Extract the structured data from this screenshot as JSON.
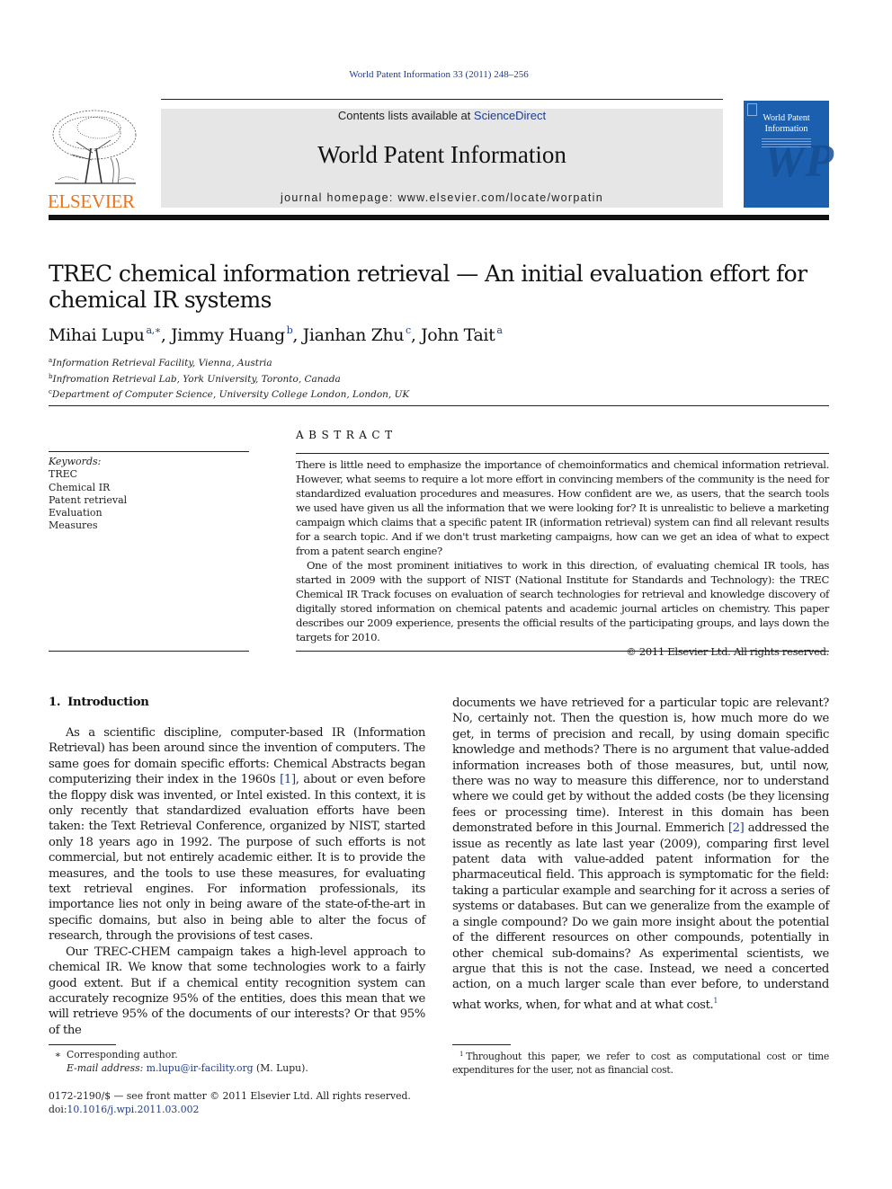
{
  "journal_ref": "World Patent Information 33 (2011) 248–256",
  "masthead": {
    "contents_prefix": "Contents lists available at ",
    "contents_link": "ScienceDirect",
    "journal_title": "World Patent Information",
    "homepage": "journal homepage: www.elsevier.com/locate/worpatin",
    "publisher": "ELSEVIER",
    "cover_title_line1": "World Patent",
    "cover_title_line2": "Information",
    "cover_monogram": "WP"
  },
  "article": {
    "title": "TREC chemical information retrieval — An initial evaluation effort for chemical IR systems",
    "authors": [
      {
        "name": "Mihai Lupu",
        "sup": "a,∗",
        "sep": ", "
      },
      {
        "name": "Jimmy Huang",
        "sup": "b",
        "sep": ", "
      },
      {
        "name": "Jianhan Zhu",
        "sup": "c",
        "sep": ", "
      },
      {
        "name": "John Tait",
        "sup": "a",
        "sep": ""
      }
    ],
    "affiliations": [
      {
        "sup": "a",
        "text": "Information Retrieval Facility, Vienna, Austria"
      },
      {
        "sup": "b",
        "text": "Infromation Retrieval Lab, York University, Toronto, Canada"
      },
      {
        "sup": "c",
        "text": "Department of Computer Science, University College London, London, UK"
      }
    ]
  },
  "keywords": {
    "label": "Keywords:",
    "items": [
      "TREC",
      "Chemical IR",
      "Patent retrieval",
      "Evaluation",
      "Measures"
    ]
  },
  "abstract": {
    "heading": "ABSTRACT",
    "paragraphs": [
      "There is little need to emphasize the importance of chemoinformatics and chemical information retrieval. However, what seems to require a lot more effort in convincing members of the community is the need for standardized evaluation procedures and measures. How confident are we, as users, that the search tools we used have given us all the information that we were looking for? It is unrealistic to believe a marketing campaign which claims that a specific patent IR (information retrieval) system can find all relevant results for a search topic. And if we don't trust marketing campaigns, how can we get an idea of what to expect from a patent search engine?",
      "One of the most prominent initiatives to work in this direction, of evaluating chemical IR tools, has started in 2009 with the support of NIST (National Institute for Standards and Technology): the TREC Chemical IR Track focuses on evaluation of search technologies for retrieval and knowledge discovery of digitally stored information on chemical patents and academic journal articles on chemistry. This paper describes our 2009 experience, presents the official results of the participating groups, and lays down the targets for 2010."
    ],
    "copyright": "© 2011 Elsevier Ltd. All rights reserved."
  },
  "introduction": {
    "number": "1.",
    "title": "Introduction",
    "p1_a": "As a scientific discipline, computer-based IR (Information Retrieval) has been around since the invention of computers. The same goes for domain specific efforts: Chemical Abstracts began computerizing their index in the 1960s ",
    "p1_ref": "[1]",
    "p1_b": ", about or even before the floppy disk was invented, or Intel existed. In this context, it is only recently that standardized evaluation efforts have been taken: the Text Retrieval Conference, organized by NIST, started only 18 years ago in 1992. The purpose of such efforts is not commercial, but not entirely academic either. It is to provide the measures, and the tools to use these measures, for evaluating text retrieval engines. For information professionals, its importance lies not only in being aware of the state-of-the-art in specific domains, but also in being able to alter the focus of research, through the provisions of test cases.",
    "p2": "Our TREC-CHEM campaign takes a high-level approach to chemical IR. We know that some technologies work to a fairly good extent. But if a chemical entity recognition system can accurately recognize 95% of the entities, does this mean that we will retrieve 95% of the documents of our interests? Or that 95% of the",
    "p3_a": "documents we have retrieved for a particular topic are relevant? No, certainly not. Then the question is, how much more do we get, in terms of precision and recall, by using domain specific knowledge and methods? There is no argument that value-added information increases both of those measures, but, until now, there was no way to measure this difference, nor to understand where we could get by without the added costs (be they licensing fees or processing time). Interest in this domain has been demonstrated before in this Journal. Emmerich ",
    "p3_ref": "[2]",
    "p3_b": " addressed the issue as recently as late last year (2009), comparing first level patent data with value-added patent information for the pharmaceutical field. This approach is symptomatic for the field: taking a particular example and searching for it across a series of systems or databases. But can we generalize from the example of a single compound? Do we gain more insight about the potential of the different resources on other compounds, potentially in other chemical sub-domains? As experimental scientists, we argue that this is not the case. Instead, we need a concerted action, on a much larger scale than ever before, to understand what works, when, for what and at what cost.",
    "p3_fn": "1"
  },
  "footnotes": {
    "corresponding_mark": "∗",
    "corresponding_text": "Corresponding author.",
    "email_label": "E-mail address:",
    "email": "m.lupu@ir-facility.org",
    "email_suffix": " (M. Lupu).",
    "fn1_mark": "1",
    "fn1_text": "Throughout this paper, we refer to cost as computational cost or time expenditures for the user, not as financial cost."
  },
  "front_matter": {
    "issn_line": "0172-2190/$ — see front matter © 2011 Elsevier Ltd. All rights reserved.",
    "doi_prefix": "doi:",
    "doi": "10.1016/j.wpi.2011.03.002"
  },
  "colors": {
    "link": "#1f3d8c",
    "elsevier_orange": "#e8731e",
    "masthead_bg": "#e6e6e6",
    "cover_blue": "#1c5fae"
  }
}
